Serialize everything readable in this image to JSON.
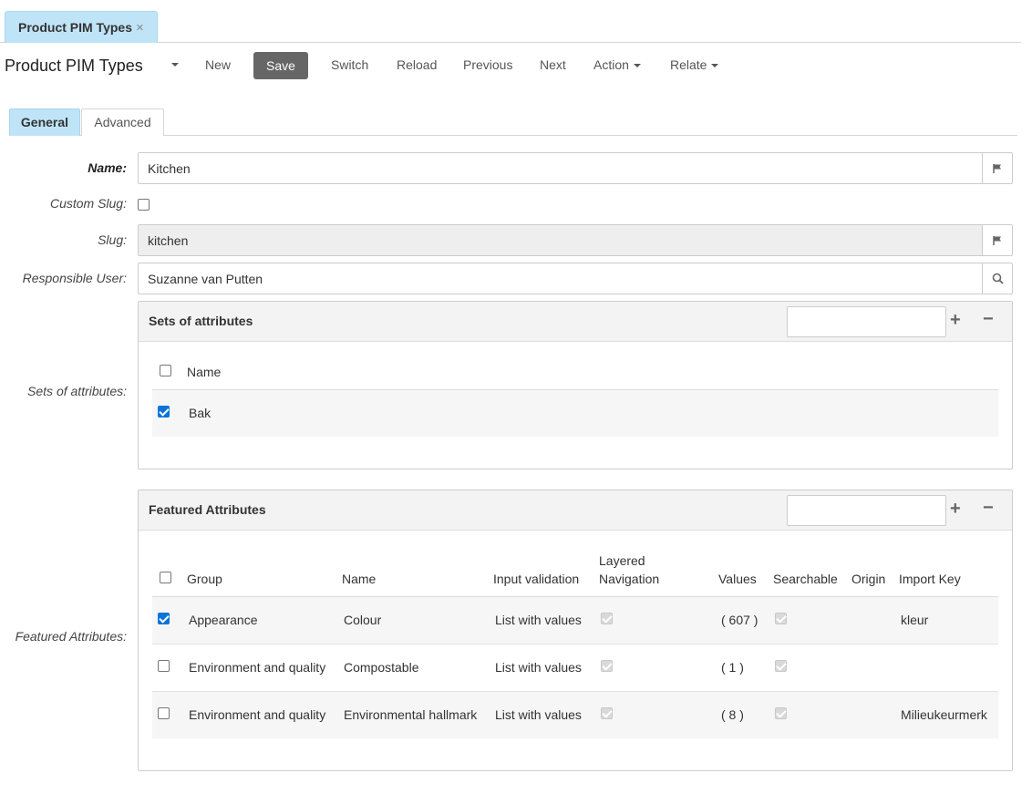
{
  "doc_tab": {
    "label": "Product PIM Types",
    "close": "×"
  },
  "toolbar": {
    "title": "Product PIM Types",
    "new": "New",
    "save": "Save",
    "switch": "Switch",
    "reload": "Reload",
    "previous": "Previous",
    "next": "Next",
    "action": "Action",
    "relate": "Relate"
  },
  "tabs": {
    "general": "General",
    "advanced": "Advanced"
  },
  "form": {
    "name_label": "Name:",
    "name_value": "Kitchen",
    "custom_slug_label": "Custom Slug:",
    "custom_slug_checked": false,
    "slug_label": "Slug:",
    "slug_value": "kitchen",
    "responsible_label": "Responsible User:",
    "responsible_value": "Suzanne van Putten",
    "sets_label": "Sets of attributes:",
    "featured_label": "Featured Attributes:"
  },
  "sets_panel": {
    "title": "Sets of attributes",
    "plus": "+",
    "minus": "−",
    "col_name": "Name",
    "rows": [
      {
        "name": "Bak",
        "checked": true
      }
    ]
  },
  "featured_panel": {
    "title": "Featured Attributes",
    "plus": "+",
    "minus": "−",
    "columns": {
      "group": "Group",
      "name": "Name",
      "input_validation": "Input validation",
      "layered_nav_1": "Layered",
      "layered_nav_2": "Navigation",
      "values": "Values",
      "searchable": "Searchable",
      "origin": "Origin",
      "import_key": "Import Key"
    },
    "rows": [
      {
        "checked": true,
        "group": "Appearance",
        "name": "Colour",
        "input_validation": "List with values",
        "values": "( 607 )",
        "import_key": "kleur"
      },
      {
        "checked": false,
        "group": "Environment and quality",
        "name": "Compostable",
        "input_validation": "List with values",
        "values": "( 1 )",
        "import_key": ""
      },
      {
        "checked": false,
        "group": "Environment and quality",
        "name": "Environmental hallmark",
        "input_validation": "List with values",
        "values": "( 8 )",
        "import_key": "Milieukeurmerk"
      }
    ]
  },
  "icons": {
    "flag": "flag-icon",
    "search": "search-icon",
    "close": "close-icon",
    "caret": "caret-down-icon"
  }
}
